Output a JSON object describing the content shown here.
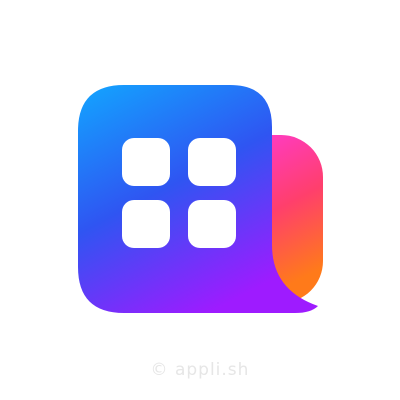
{
  "logo": {
    "name": "app-grid-logo",
    "icon": "four-square-grid-icon",
    "colors": {
      "front_top": "#12a6ff",
      "front_mid": "#2f55f2",
      "front_bottom": "#9e1bff",
      "back_top": "#ff3ad8",
      "back_mid": "#ff3f6c",
      "back_bottom": "#ff7a1a",
      "tile": "#ffffff"
    }
  },
  "watermark": {
    "text": "© appli.sh",
    "color": "#e6e6e6"
  }
}
